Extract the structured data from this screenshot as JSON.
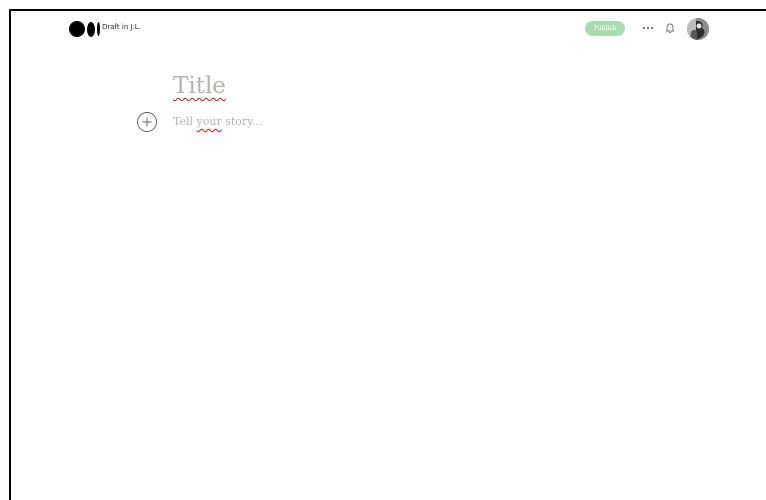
{
  "header": {
    "logo_icon": "medium-logo-icon",
    "draft_label": "Draft in J.L.",
    "publish_label": "Publish",
    "publish_color": "#a8dbb1",
    "more_icon": "more-dots-icon",
    "notifications_icon": "bell-icon",
    "avatar_icon": "user-avatar"
  },
  "editor": {
    "title_placeholder": "Title",
    "story_word_1": "Tell",
    "story_word_2": "your",
    "story_word_3": "story...",
    "add_icon": "plus-circle-icon",
    "spellcheck_underline_color": "#d01212"
  }
}
